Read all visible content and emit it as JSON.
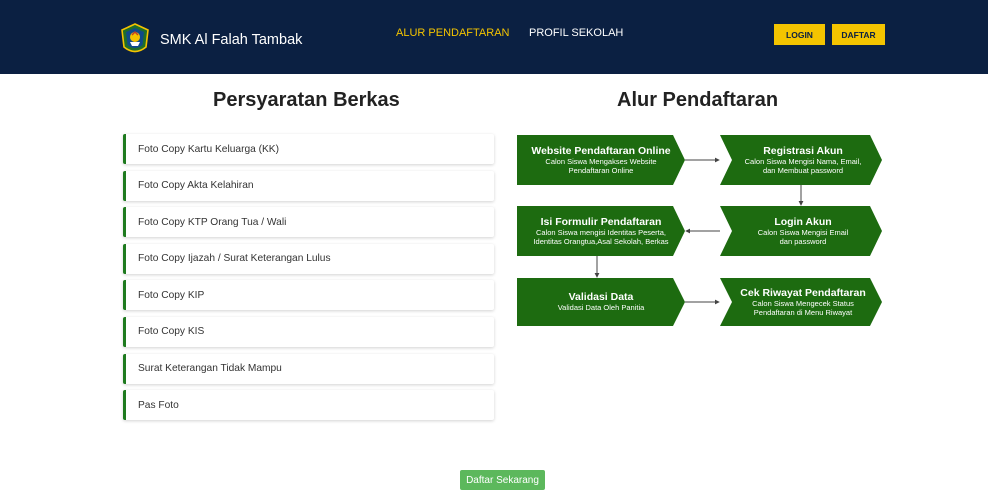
{
  "colors": {
    "navbar": "#0b2042",
    "accent": "#f4c400",
    "flow_green": "#1d6b10",
    "list_border": "#1e7a1e",
    "cta": "#5cb85c"
  },
  "nav": {
    "brand": "SMK Al Falah Tambak",
    "logo_icon": "school-emblem-icon",
    "links": [
      "ALUR PENDAFTARAN",
      "PROFIL SEKOLAH"
    ],
    "login": "LOGIN",
    "register": "DAFTAR"
  },
  "requirements": {
    "title": "Persyaratan Berkas",
    "items": [
      "Foto Copy Kartu Keluarga (KK)",
      "Foto Copy Akta Kelahiran",
      "Foto Copy KTP Orang Tua / Wali",
      "Foto Copy Ijazah / Surat Keterangan Lulus",
      "Foto Copy KIP",
      "Foto Copy KIS",
      "Surat Keterangan Tidak Mampu",
      "Pas Foto"
    ]
  },
  "flow": {
    "title": "Alur Pendaftaran",
    "steps": [
      {
        "title": "Website Pendaftaran Online",
        "desc": [
          "Calon Siswa Mengakses Website",
          "Pendaftaran Online"
        ]
      },
      {
        "title": "Registrasi Akun",
        "desc": [
          "Calon Siswa Mengisi Nama, Email,",
          "dan Membuat password"
        ]
      },
      {
        "title": "Login Akun",
        "desc": [
          "Calon Siswa Mengisi Email",
          "dan password"
        ]
      },
      {
        "title": "Isi Formulir Pendaftaran",
        "desc": [
          "Calon Siswa mengisi Identitas Peserta,",
          "Identitas Orangtua,Asal Sekolah, Berkas"
        ]
      },
      {
        "title": "Validasi Data",
        "desc": [
          "Validasi Data Oleh Panitia"
        ]
      },
      {
        "title": "Cek Riwayat Pendaftaran",
        "desc": [
          "Calon Siswa Mengecek Status",
          "Pendaftaran di Menu Riwayat"
        ]
      }
    ]
  },
  "cta": "Daftar Sekarang"
}
